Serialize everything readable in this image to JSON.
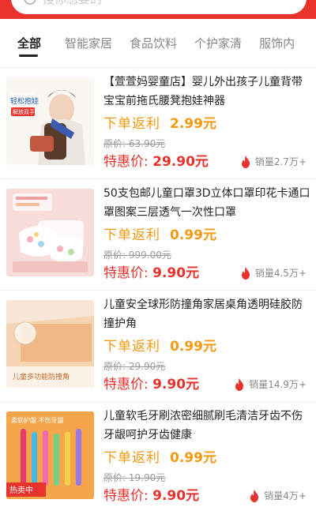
{
  "search": {
    "placeholder": "搜你想要的"
  },
  "tabs": [
    {
      "label": "全部",
      "active": true
    },
    {
      "label": "智能家居",
      "active": false
    },
    {
      "label": "食品饮料",
      "active": false
    },
    {
      "label": "个护家清",
      "active": false
    },
    {
      "label": "服饰内",
      "active": false
    }
  ],
  "labels": {
    "rebate": "下单返利",
    "special": "特惠价: ",
    "sales": "销量 "
  },
  "products": [
    {
      "title": "【萱萱妈婴童店】婴儿外出孩子儿童背带宝宝前拖氏腰凳抱娃神器",
      "rebate": "2.99元",
      "original": "原价: 63.90元",
      "price": "29.90元",
      "sales": "2.7万+",
      "image_text": [
        "轻松抱娃",
        "解放双手"
      ]
    },
    {
      "title": "50支包邮儿童口罩3D立体口罩印花卡通口罩图案三层透气一次性口罩",
      "rebate": "0.99元",
      "original": "原价: 999.00元",
      "price": "9.90元",
      "sales": "4.5万+",
      "image_text": []
    },
    {
      "title": "儿童安全球形防撞角家居桌角透明硅胶防撞护角",
      "rebate": "0.99元",
      "original": "原价: 29.90元",
      "price": "9.90元",
      "sales": "14.9万+",
      "image_text": [
        "儿童多功能防撞角"
      ]
    },
    {
      "title": "儿童软毛牙刷浓密细腻刷毛清洁牙齿不伤牙龈呵护牙齿健康",
      "rebate": "0.99元",
      "original": "原价: 19.90元",
      "price": "9.90元",
      "sales": "4万+",
      "image_text": [
        "柔软护龈 不伤牙龈",
        "热卖中"
      ]
    }
  ],
  "colors": {
    "brand_red": "#e8322c",
    "rebate_orange": "#f29a12"
  }
}
